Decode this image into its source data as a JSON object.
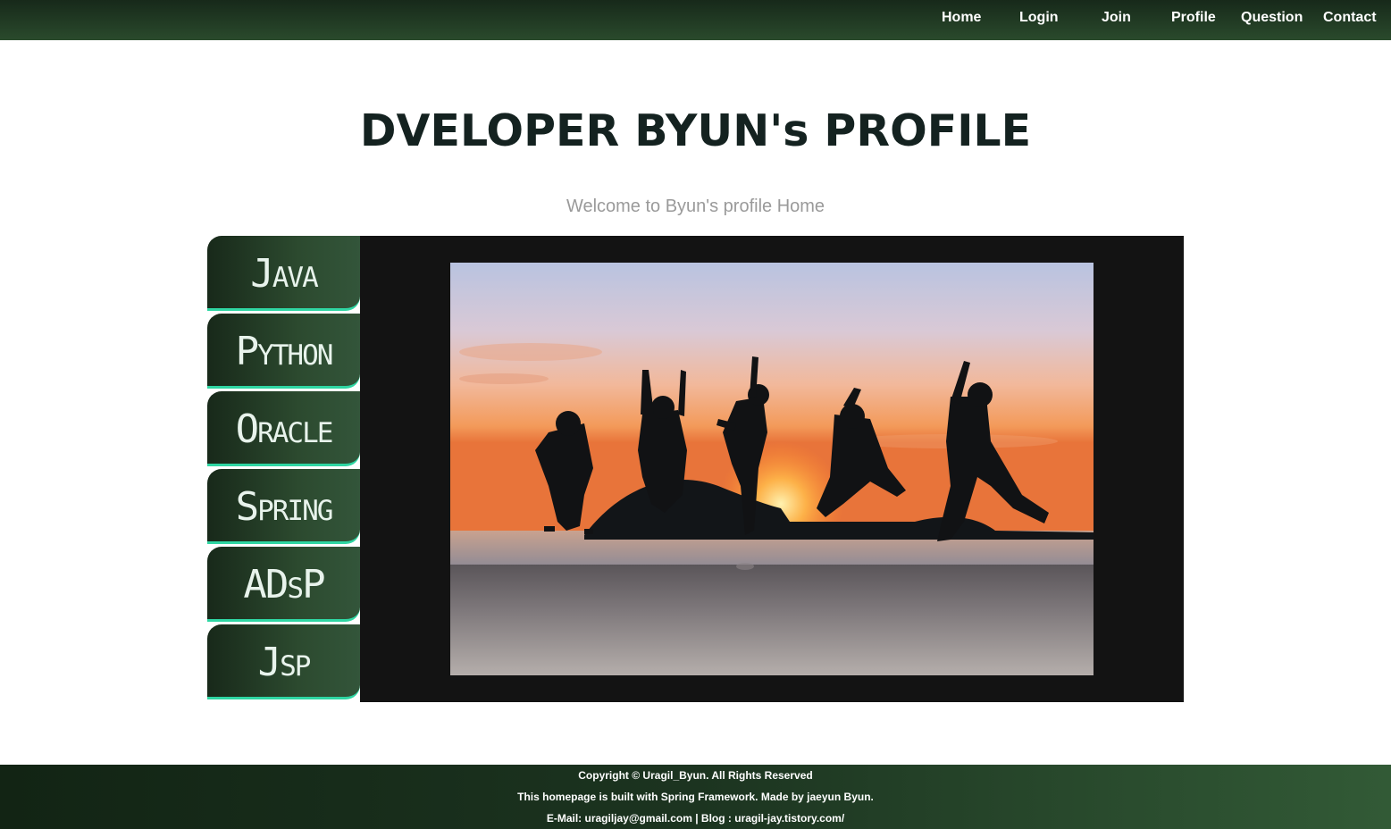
{
  "nav": {
    "items": [
      {
        "label": "Home"
      },
      {
        "label": "Login"
      },
      {
        "label": "Join"
      },
      {
        "label": "Profile"
      },
      {
        "label": "Question"
      },
      {
        "label": "Contact"
      }
    ]
  },
  "header": {
    "title": "DVELOPER BYUN's PROFILE",
    "subtitle": "Welcome to Byun's profile Home"
  },
  "sidebar": {
    "items": [
      {
        "label": "Java"
      },
      {
        "label": "Python"
      },
      {
        "label": "Oracle"
      },
      {
        "label": "Spring"
      },
      {
        "label": "ADsP"
      },
      {
        "label": "Jsp"
      }
    ]
  },
  "main": {
    "photo_icon": "group-jumping-on-beach-at-sunset-photo"
  },
  "footer": {
    "copyright": "Copyright © Uragil_Byun. All Rights Reserved",
    "built_with": "This homepage is built with Spring Framework. Made by jaeyun Byun.",
    "contact": "E-Mail: uragiljay@gmail.com | Blog : uragil-jay.tistory.com/"
  },
  "colors": {
    "nav_bg": "#1d3320",
    "title": "#142220",
    "subtitle": "#9a9a9a",
    "menu_accent": "#2fd6a3",
    "panel_bg": "#131313"
  }
}
